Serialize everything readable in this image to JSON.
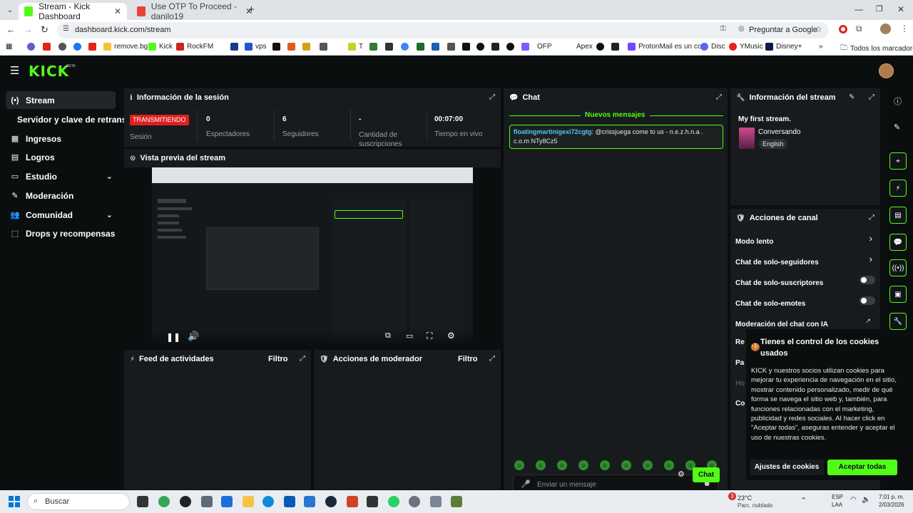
{
  "browser": {
    "tabs": [
      {
        "title": "Stream - Kick Dashboard",
        "active": true
      },
      {
        "title": "Use OTP To Proceed - danilo19",
        "active": false
      }
    ],
    "new_tab_symbol": "+",
    "url": "dashboard.kick.com/stream",
    "google_lens": "Preguntar a Google",
    "bookmarks": [
      "remove.bg",
      "Kick",
      "RockFM",
      "vps",
      "T",
      "OFP",
      "Apex",
      "ProtonMail es un co...",
      "Disc",
      "YMusic",
      "Disney+"
    ],
    "all_bookmarks": "Todos los marcadores",
    "more_symbol": "»"
  },
  "kick": {
    "logo": "KICK",
    "logo_badge": "BETA",
    "sidebar": {
      "items": [
        {
          "label": "Stream",
          "icon": "(•)"
        },
        {
          "label": "Servidor y clave de retransm",
          "icon": ""
        },
        {
          "label": "Ingresos",
          "icon": "▦"
        },
        {
          "label": "Logros",
          "icon": "▤"
        },
        {
          "label": "Estudio",
          "icon": "▭"
        },
        {
          "label": "Moderación",
          "icon": "✎"
        },
        {
          "label": "Comunidad",
          "icon": "👥"
        },
        {
          "label": "Drops y recompensas",
          "icon": "⬚"
        }
      ]
    },
    "session": {
      "title": "Información de la sesión",
      "live_badge": "TRANSMITIENDO",
      "session_label": "Sesión",
      "stats": [
        {
          "value": "0",
          "label": "Espectadores"
        },
        {
          "value": "6",
          "label": "Seguidores"
        },
        {
          "value": "-",
          "label": "Cantidad de suscripciones"
        },
        {
          "value": "00:07:00",
          "label": "Tiempo en vivo"
        }
      ]
    },
    "preview": {
      "title": "Vista previa del stream"
    },
    "feed": {
      "title": "Feed de actividades",
      "filter": "Filtro"
    },
    "modactions": {
      "title": "Acciones de moderador",
      "filter": "Filtro"
    },
    "chat": {
      "title": "Chat",
      "new_messages": "Nuevos mensajes",
      "message_user": "floatingmartinigexi72cgtg",
      "message_text": "@crissjuega come to us - n.e.z.h.n.a . c.o.m NTy8Cz5",
      "input_placeholder": "Enviar un mensaje",
      "send_label": "Chat"
    },
    "stream_info": {
      "title": "Información del stream",
      "stream_title": "My first stream.",
      "category": "Conversando",
      "language": "English"
    },
    "channel_actions": {
      "title": "Acciones de canal",
      "items": [
        {
          "label": "Modo lento",
          "control": "arrow"
        },
        {
          "label": "Chat de solo-seguidores",
          "control": "arrow"
        },
        {
          "label": "Chat de solo-suscriptores",
          "control": "toggle"
        },
        {
          "label": "Chat de solo-emotes",
          "control": "toggle"
        },
        {
          "label": "Moderación del chat con IA",
          "control": "link"
        }
      ],
      "partial_rows": [
        "Re",
        "Pa",
        "Ho",
        "Co"
      ]
    },
    "cookie": {
      "title": "Tienes el control de los cookies usados",
      "body": "KICK y nuestros socios utilizan cookies para mejorar tu experiencia de navegación en el sitio, mostrar contenido personalizado, medir de qué forma se navega el sitio web y, también, para funciones relacionadas con el marketing, publicidad y redes sociales. Al hacer click en \"Aceptar todas\", aseguras entender y aceptar el uso de nuestras cookies.",
      "settings_button": "Ajustes de cookies",
      "accept_button": "Aceptar todas"
    },
    "colors": {
      "accent": "#53fc18",
      "live": "#e01f1f",
      "panel": "#181b1d",
      "bg": "#0b0e0f"
    }
  },
  "taskbar": {
    "search": "Buscar",
    "weather_temp": "23°C",
    "weather_desc": "Parc. nublado",
    "weather_badge": "3",
    "lang": "ESP",
    "lang2": "LAA",
    "time": "7:01 p. m.",
    "date": "2/03/2026"
  }
}
